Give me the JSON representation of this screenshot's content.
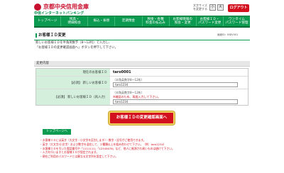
{
  "header": {
    "bank_name": "京都中央信用金庫",
    "service_name": "中信インターネットバンキング",
    "font_size_label": "文字サイズを変更する",
    "font_small": "小",
    "font_large": "大",
    "logout_label": "ログアウト"
  },
  "nav": [
    "トップページ",
    "残高・\n明細照会",
    "振込・振替",
    "定期預金",
    "税金・各種\n料金の払込み",
    "お客様情報の\n照会・変更",
    "お客様ＩＤ・\nパスワード変更",
    "ワンタイム\nパスワード管理"
  ],
  "page": {
    "title": "お客様ＩＤ変更",
    "screen_id": "画面ID：BIDV001",
    "desc_line1": "新しいお客様ＩＤを半角英数字（8〜12桁）で入力し、",
    "desc_line2": "「お客様ＩＤの変更確認画面へ」ボタンを押下して下さい。"
  },
  "form": {
    "section_title": "変更内容",
    "current_label": "現在のお客様ＩＤ",
    "current_value": "taro0001",
    "new_label": "【必須】 新しいお客様ＩＤ",
    "new_note": "（半角英数字8〜12桁）",
    "new_value": "taro1234",
    "confirm_label": "【必須】 新しいお客様ＩＤ（再入力）",
    "confirm_note": "（半角英数字8〜12桁）",
    "confirm_warning": "※確認のため、再度入力して下さい。",
    "confirm_value": "taro1234"
  },
  "submit_label": "お客様ＩＤの変更確認画面へ",
  "top_link_label": "トップページへ",
  "notes": [
    "・お客様ＩＤには英字（大文字・小文字を区別します）・数字・記号がご使用できます。",
    "・英字（大文字/小文字）および数字を混在して、２種類以上を組み合わせて下さい。（例：taro1234）",
    "・お客様ＩＤを引いた電話番号や「1111111」「12345678」など、他人に推測され易いものは避けて下さい。",
    "・入力を行いますとお客様ＩＤが設定されます。",
    "・現在ご利用のパスワードとは異なる文字列を設定して下さい。"
  ],
  "colors": {
    "brand_green": "#0a9a50",
    "brand_red": "#d3101e",
    "label_bg": "#d4f0dd"
  }
}
